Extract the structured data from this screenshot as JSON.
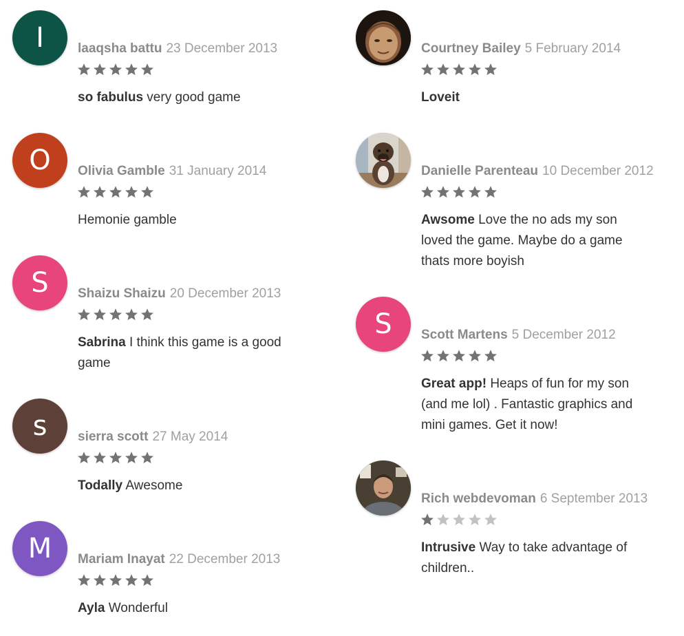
{
  "colors": {
    "star_filled": "#737373",
    "star_empty": "#c2c2c2",
    "author": "#8a8a8a",
    "date": "#a0a0a0",
    "text": "#333333"
  },
  "reviews": [
    {
      "avatar_letter": "I",
      "avatar_color": "#0d5346",
      "author": "laaqsha battu",
      "date": "23 December 2013",
      "rating": 5,
      "title": "so fabulus",
      "body": "very good game"
    },
    {
      "avatar_letter": "O",
      "avatar_color": "#c0401d",
      "author": "Olivia Gamble",
      "date": "31 January 2014",
      "rating": 5,
      "title": "",
      "body": "Hemonie gamble"
    },
    {
      "avatar_letter": "S",
      "avatar_color": "#e8457c",
      "author": "Shaizu Shaizu",
      "date": "20 December 2013",
      "rating": 5,
      "title": "Sabrina",
      "body": "I think this game is a good game"
    },
    {
      "avatar_letter": "s",
      "avatar_color": "#5d4038",
      "author": "sierra scott",
      "date": "27 May 2014",
      "rating": 5,
      "title": "Todally",
      "body": "Awesome"
    },
    {
      "avatar_letter": "M",
      "avatar_color": "#7e57c2",
      "author": "Mariam Inayat",
      "date": "22 December 2013",
      "rating": 5,
      "title": "Ayla",
      "body": "Wonderful"
    },
    {
      "avatar_letter": "",
      "avatar_color": "#6b5540",
      "avatar_icon": "child-face-photo",
      "author": "Courtney Bailey",
      "date": "5 February 2014",
      "rating": 5,
      "title": "Loveit",
      "body": ""
    },
    {
      "avatar_letter": "",
      "avatar_color": "#b9b3a8",
      "avatar_icon": "dog-photo",
      "author": "Danielle Parenteau",
      "date": "10 December 2012",
      "rating": 5,
      "title": "Awsome",
      "body": "Love the no ads my son loved the game. Maybe do a game thats more boyish"
    },
    {
      "avatar_letter": "S",
      "avatar_color": "#e8457c",
      "author": "Scott Martens",
      "date": "5 December 2012",
      "rating": 5,
      "title": "Great app!",
      "body": "Heaps of fun for my son (and me lol) . Fantastic graphics and mini games. Get it now!"
    },
    {
      "avatar_letter": "",
      "avatar_color": "#6f6a60",
      "avatar_icon": "man-photo",
      "author": "Rich webdevoman",
      "date": "6 September 2013",
      "rating": 1,
      "title": "Intrusive",
      "body": "Way to take advantage of children.."
    }
  ]
}
